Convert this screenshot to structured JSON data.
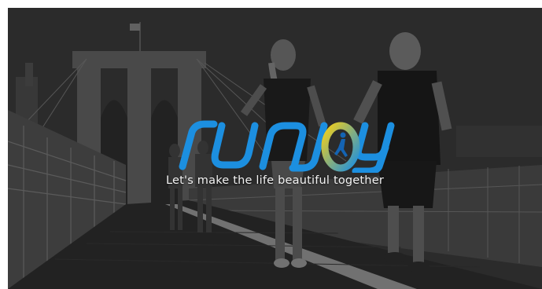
{
  "hero": {
    "logo_text": "runjoy",
    "tagline": "Let's make the life beautiful together",
    "brand_colors": {
      "primary_blue": "#1c8fe0",
      "yellow": "#f5d018",
      "dark_blue": "#1464b4"
    },
    "background": "black-and-white photo of runners on a bridge"
  }
}
